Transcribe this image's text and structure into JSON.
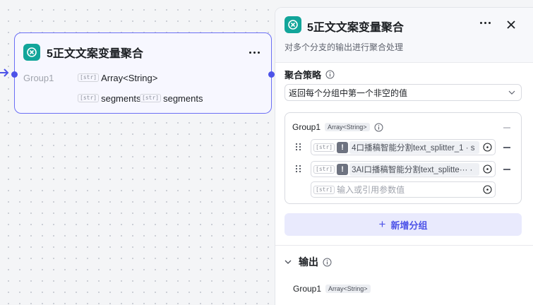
{
  "node": {
    "title": "5正文文案变量聚合",
    "group_label": "Group1",
    "output_type": "Array<String>",
    "inputs": [
      "segments",
      "segments"
    ]
  },
  "panel": {
    "title": "5正文文案变量聚合",
    "description": "对多个分支的输出进行聚合处理",
    "strategy_label": "聚合策略",
    "strategy_value": "返回每个分组中第一个非空的值",
    "group": {
      "name": "Group1",
      "type": "Array<String>",
      "refs": [
        "4口播稿智能分割text_splitter_1 · s",
        "3AI口播稿智能分割text_splitte··· ·"
      ],
      "placeholder": "输入或引用参数值"
    },
    "add_group_label": "新增分组",
    "output_label": "输出",
    "output_group": {
      "name": "Group1",
      "type": "Array<String>"
    }
  },
  "badge_text": "[str]",
  "colors": {
    "accent": "#4d53e8",
    "icon_bg": "#12a59a"
  }
}
